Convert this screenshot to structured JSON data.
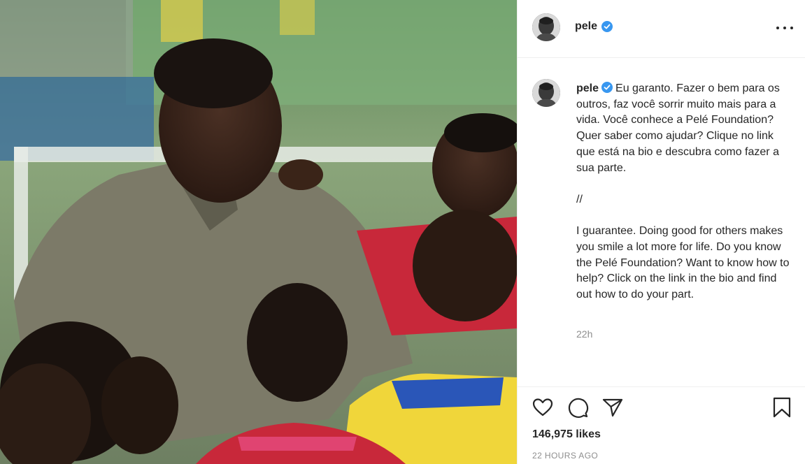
{
  "post": {
    "username": "pele",
    "verified": true,
    "caption": {
      "username": "pele",
      "text": "Eu garanto. Fazer o bem para os outros, faz você sorrir muito mais para a vida. Você conhece a Pelé Foundation? Quer saber como ajudar? Clique no link que está na bio e descubra como fazer a sua parte.\n\n//\n\nI guarantee. Doing good for others makes you smile a lot more for life. Do you know the Pelé Foundation? Want to know how to help? Click on the link in the bio and find out how to do your part."
    },
    "timestamp": "22h",
    "likes": "146,975 likes",
    "time_ago": "22 HOURS AGO"
  },
  "icons": {
    "more": "more-options-icon",
    "verified": "verified-badge-icon",
    "like": "heart-icon",
    "comment": "comment-icon",
    "share": "paper-plane-icon",
    "save": "bookmark-icon"
  },
  "colors": {
    "verified_blue": "#3897f0",
    "text": "#262626",
    "muted": "#8e8e8e",
    "divider": "#efefef"
  }
}
